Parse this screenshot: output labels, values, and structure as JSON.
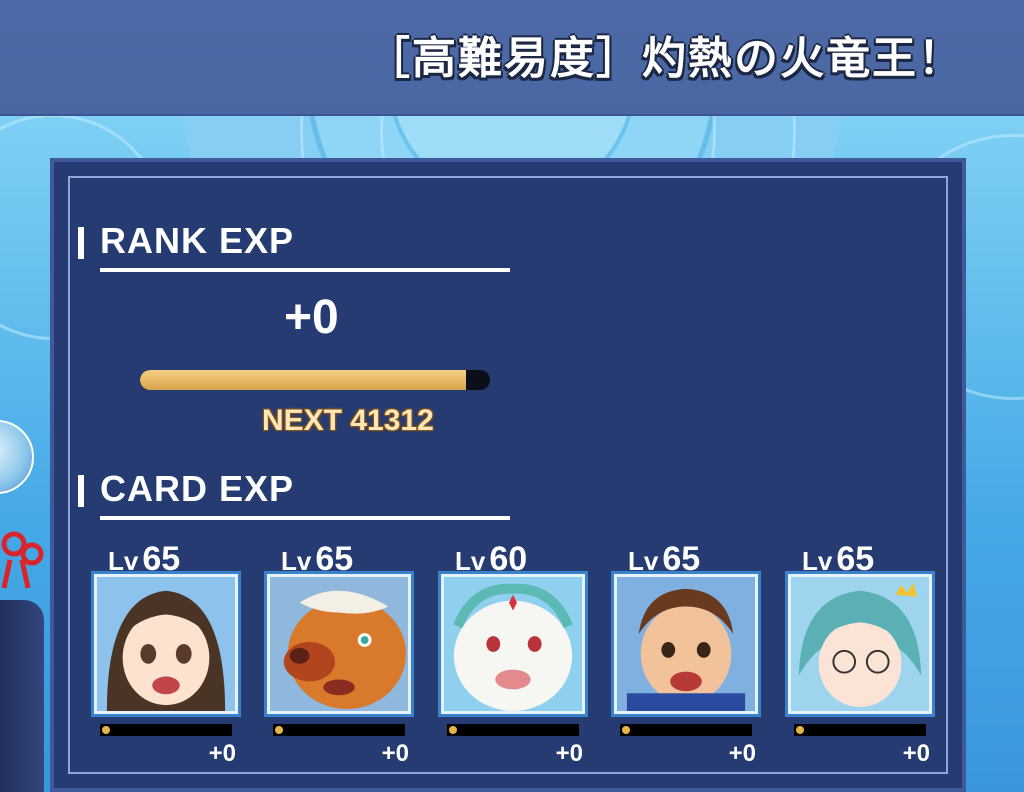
{
  "header": {
    "title": "［高難易度］灼熱の火竜王！"
  },
  "rank_exp": {
    "title": "RANK EXP",
    "gain": "+0",
    "progress": 0.93,
    "next_label": "NEXT 41312"
  },
  "card_exp": {
    "title": "CARD EXP",
    "lv_label": "Lv",
    "cards": [
      {
        "level": "65",
        "gain": "+0",
        "progress": 0.0,
        "portrait": "girl-dark-hair-portrait"
      },
      {
        "level": "65",
        "gain": "+0",
        "progress": 0.0,
        "portrait": "bear-beast-portrait"
      },
      {
        "level": "60",
        "gain": "+0",
        "progress": 0.0,
        "portrait": "white-lion-portrait"
      },
      {
        "level": "65",
        "gain": "+0",
        "progress": 0.0,
        "portrait": "brown-hair-boy-portrait"
      },
      {
        "level": "65",
        "gain": "+0",
        "progress": 0.0,
        "portrait": "teal-hair-glasses-portrait"
      }
    ]
  },
  "colors": {
    "panel": "#253b72",
    "header": "#4d6aa8",
    "rank_bar_fill": "#d9a54b",
    "exp_dot": "#e6b548"
  }
}
